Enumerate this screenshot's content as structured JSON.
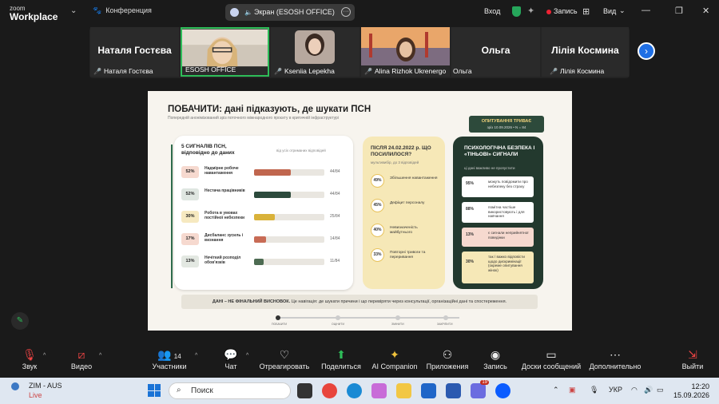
{
  "app": {
    "brand_line1": "zoom",
    "brand_line2": "Workplace",
    "conference": "Конференция"
  },
  "share": {
    "label": "Экран (ESOSH OFFICE)"
  },
  "topright": {
    "signin": "Вход",
    "record": "Запись",
    "view": "Вид"
  },
  "participants": [
    {
      "big": "Наталя Гостєва",
      "caption": "Наталя Гостєва",
      "muted": true
    },
    {
      "big": "",
      "caption": "ESOSH OFFICE",
      "muted": false
    },
    {
      "big": "",
      "caption": "Kseniia Lepekha",
      "muted": true
    },
    {
      "big": "",
      "caption": "Alina Rizhok Ukrenergo",
      "muted": true
    },
    {
      "big": "Ольга",
      "caption": "Ольга",
      "muted": false
    },
    {
      "big": "Лілія Космина",
      "caption": "Лілія Космина",
      "muted": true
    }
  ],
  "slide": {
    "title": "ПОБАЧИТИ: дані підказують, де шукати ПСН",
    "subtitle": "Попередній анонімізований зріз поточного міжнародного проєкту в критичній інфраструктурі",
    "badge": {
      "line1": "ОПИТУВАННЯ ТРИВАЄ",
      "line2": "зріз 10.09.2026 • N = 84"
    },
    "card1": {
      "title": "5 СИГНАЛІВ ПСН, відповідно до даних",
      "hint": "від усіх отриманих відповідей",
      "rows": [
        {
          "pct": "52%",
          "label": "Надмірне робоче навантаження",
          "value": 44,
          "count": "44/84",
          "color": "#c0664e",
          "bg": "#f6d9cf"
        },
        {
          "pct": "52%",
          "label": "Нестача працівників",
          "value": 44,
          "count": "44/84",
          "color": "#2c4a3c",
          "bg": "#dfe6e1"
        },
        {
          "pct": "30%",
          "label": "Робота в умовах постійної небезпеки",
          "value": 25,
          "count": "25/84",
          "color": "#d9b23a",
          "bg": "#f6e9c0"
        },
        {
          "pct": "17%",
          "label": "Дисбаланс зусиль і визнання",
          "value": 14,
          "count": "14/84",
          "color": "#c86b55",
          "bg": "#f6d9cf"
        },
        {
          "pct": "13%",
          "label": "Нечіткий розподіл обов'язків",
          "value": 11,
          "count": "11/84",
          "color": "#4d6b52",
          "bg": "#e3e8e2"
        }
      ]
    },
    "card2": {
      "title": "ПІСЛЯ 24.02.2022 р. ЩО ПОСИЛИЛОСЯ?",
      "sub": "мультивибір, до 3 відповідей",
      "rows": [
        {
          "pct": "49%",
          "label": "Збільшення навантаження"
        },
        {
          "pct": "45%",
          "label": "Дефіцит персоналу"
        },
        {
          "pct": "40%",
          "label": "Невизначеність майбутнього"
        },
        {
          "pct": "33%",
          "label": "Повторні тривоги та переривання"
        }
      ]
    },
    "card3": {
      "title": "ПСИХОЛОГІЧНА БЕЗПЕКА І «ТІНЬОВІ» СИГНАЛИ",
      "sub": "ці дані важливо не пропустити",
      "rows": [
        {
          "pct": "95%",
          "label": "можуть повідомити про небезпеку без страху",
          "bg": "#ffffff"
        },
        {
          "pct": "88%",
          "label": "помітна частіше використовують і для навчання",
          "bg": "#ffffff"
        },
        {
          "pct": "13%",
          "label": "є сигнали неприйнятної поведінки",
          "bg": "#f6d9cf"
        },
        {
          "pct": "30%",
          "label": "так / важко відповісти щодо дискримінації (окреме опитування жінок)",
          "bg": "#f6e8b7"
        }
      ]
    },
    "conclusion_bold": "ДАНІ – НЕ ФІНАЛЬНИЙ ВИСНОВОК.",
    "conclusion_rest": " Це навігація: де шукати причини і що перевіряти через консультації, організаційні дані та спостереження.",
    "timeline": [
      "ПОБАЧИТИ",
      "ОЦІНИТИ",
      "ЗМІНИТИ",
      "ЗАКРІПИТИ"
    ]
  },
  "toolbar": {
    "mic": "Звук",
    "video": "Видео",
    "participants": "Участники",
    "participants_count": "14",
    "chat": "Чат",
    "react": "Отреагировать",
    "share": "Поделиться",
    "ai": "AI Companion",
    "apps": "Приложения",
    "record": "Запись",
    "whiteboards": "Доски сообщений",
    "more": "Дополнительно",
    "leave": "Выйти"
  },
  "taskbar": {
    "weather_title": "ZIM - AUS",
    "weather_status": "Live",
    "search": "Поиск",
    "lang": "УКР",
    "time": "12:20",
    "date": "15.09.2026",
    "badge": "19"
  }
}
